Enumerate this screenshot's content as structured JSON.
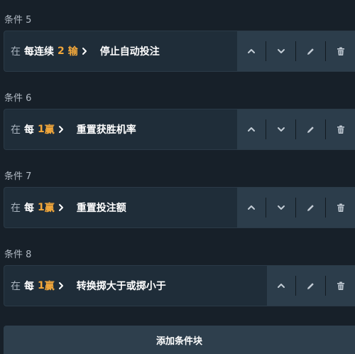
{
  "conditions": [
    {
      "label": "条件 5",
      "prefix": "在",
      "every": "每连续",
      "count": "2",
      "unit": "输",
      "action": "停止自动投注",
      "buttons": [
        "up",
        "down",
        "edit",
        "delete"
      ]
    },
    {
      "label": "条件 6",
      "prefix": "在",
      "every": "每",
      "count": "1",
      "unit": "赢",
      "action": "重置获胜机率",
      "buttons": [
        "up",
        "down",
        "edit",
        "delete"
      ]
    },
    {
      "label": "条件 7",
      "prefix": "在",
      "every": "每",
      "count": "1",
      "unit": "赢",
      "action": "重置投注额",
      "buttons": [
        "up",
        "down",
        "edit",
        "delete"
      ]
    },
    {
      "label": "条件 8",
      "prefix": "在",
      "every": "每",
      "count": "1",
      "unit": "赢",
      "action": "转换掷大于或掷小于",
      "buttons": [
        "up",
        "edit",
        "delete"
      ]
    }
  ],
  "add_button": {
    "label": "添加条件块"
  },
  "icons": {
    "up": "chevron-up-icon",
    "down": "chevron-down-icon",
    "edit": "pencil-icon",
    "delete": "trash-icon",
    "inline": "chevron-right-icon"
  },
  "colors": {
    "background": "#172029",
    "card": "#1f2d39",
    "button_group": "#2c3d4b",
    "accent": "#f3a83b",
    "label": "#b1bac4"
  }
}
